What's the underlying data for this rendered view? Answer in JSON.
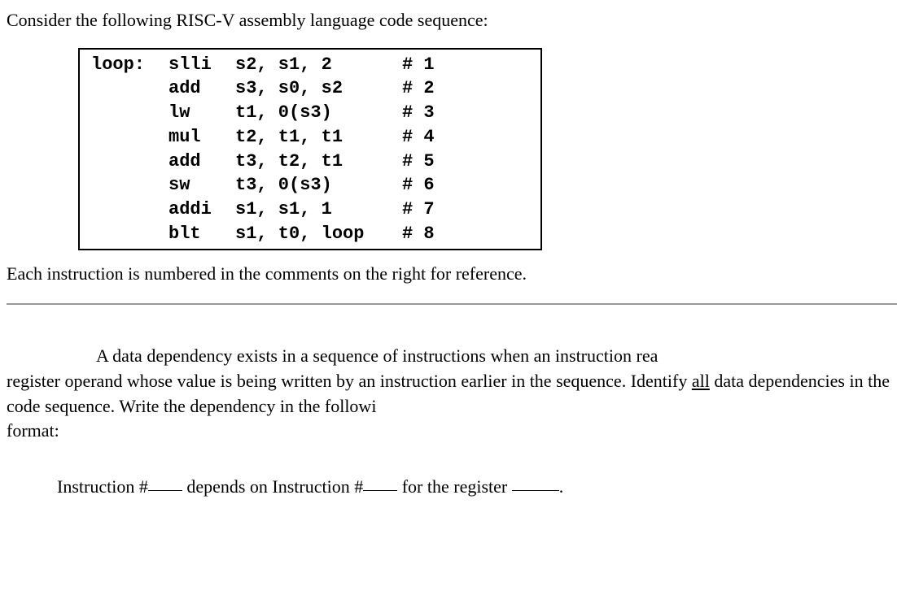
{
  "intro": "Consider the following RISC-V assembly language code sequence:",
  "code": {
    "rows": [
      {
        "label": "loop:",
        "op": "slli",
        "args": "s2, s1, 2",
        "comment": "# 1"
      },
      {
        "label": "",
        "op": "add",
        "args": "s3, s0, s2",
        "comment": "# 2"
      },
      {
        "label": "",
        "op": "lw",
        "args": "t1, 0(s3)",
        "comment": "# 3"
      },
      {
        "label": "",
        "op": "mul",
        "args": "t2, t1, t1",
        "comment": "# 4"
      },
      {
        "label": "",
        "op": "add",
        "args": "t3, t2, t1",
        "comment": "# 5"
      },
      {
        "label": "",
        "op": "sw",
        "args": "t3, 0(s3)",
        "comment": "# 6"
      },
      {
        "label": "",
        "op": "addi",
        "args": "s1, s1, 1",
        "comment": "# 7"
      },
      {
        "label": "",
        "op": "blt",
        "args": "s1, t0, loop",
        "comment": "# 8"
      }
    ]
  },
  "after_code": "Each instruction is numbered in the comments on the right for reference.",
  "paragraph_part1": "A data dependency exists in a sequence of instructions when an instruction rea",
  "paragraph_part2": "register operand whose value is being written by an instruction earlier in the sequence.  Identify ",
  "paragraph_all": "all",
  "paragraph_part3": " data dependencies in the code sequence.  Write the dependency in the followi",
  "paragraph_part4": "format:",
  "format_text": {
    "t1": "Instruction #",
    "t2": " depends on Instruction #",
    "t3": " for the register ",
    "t4": "."
  }
}
